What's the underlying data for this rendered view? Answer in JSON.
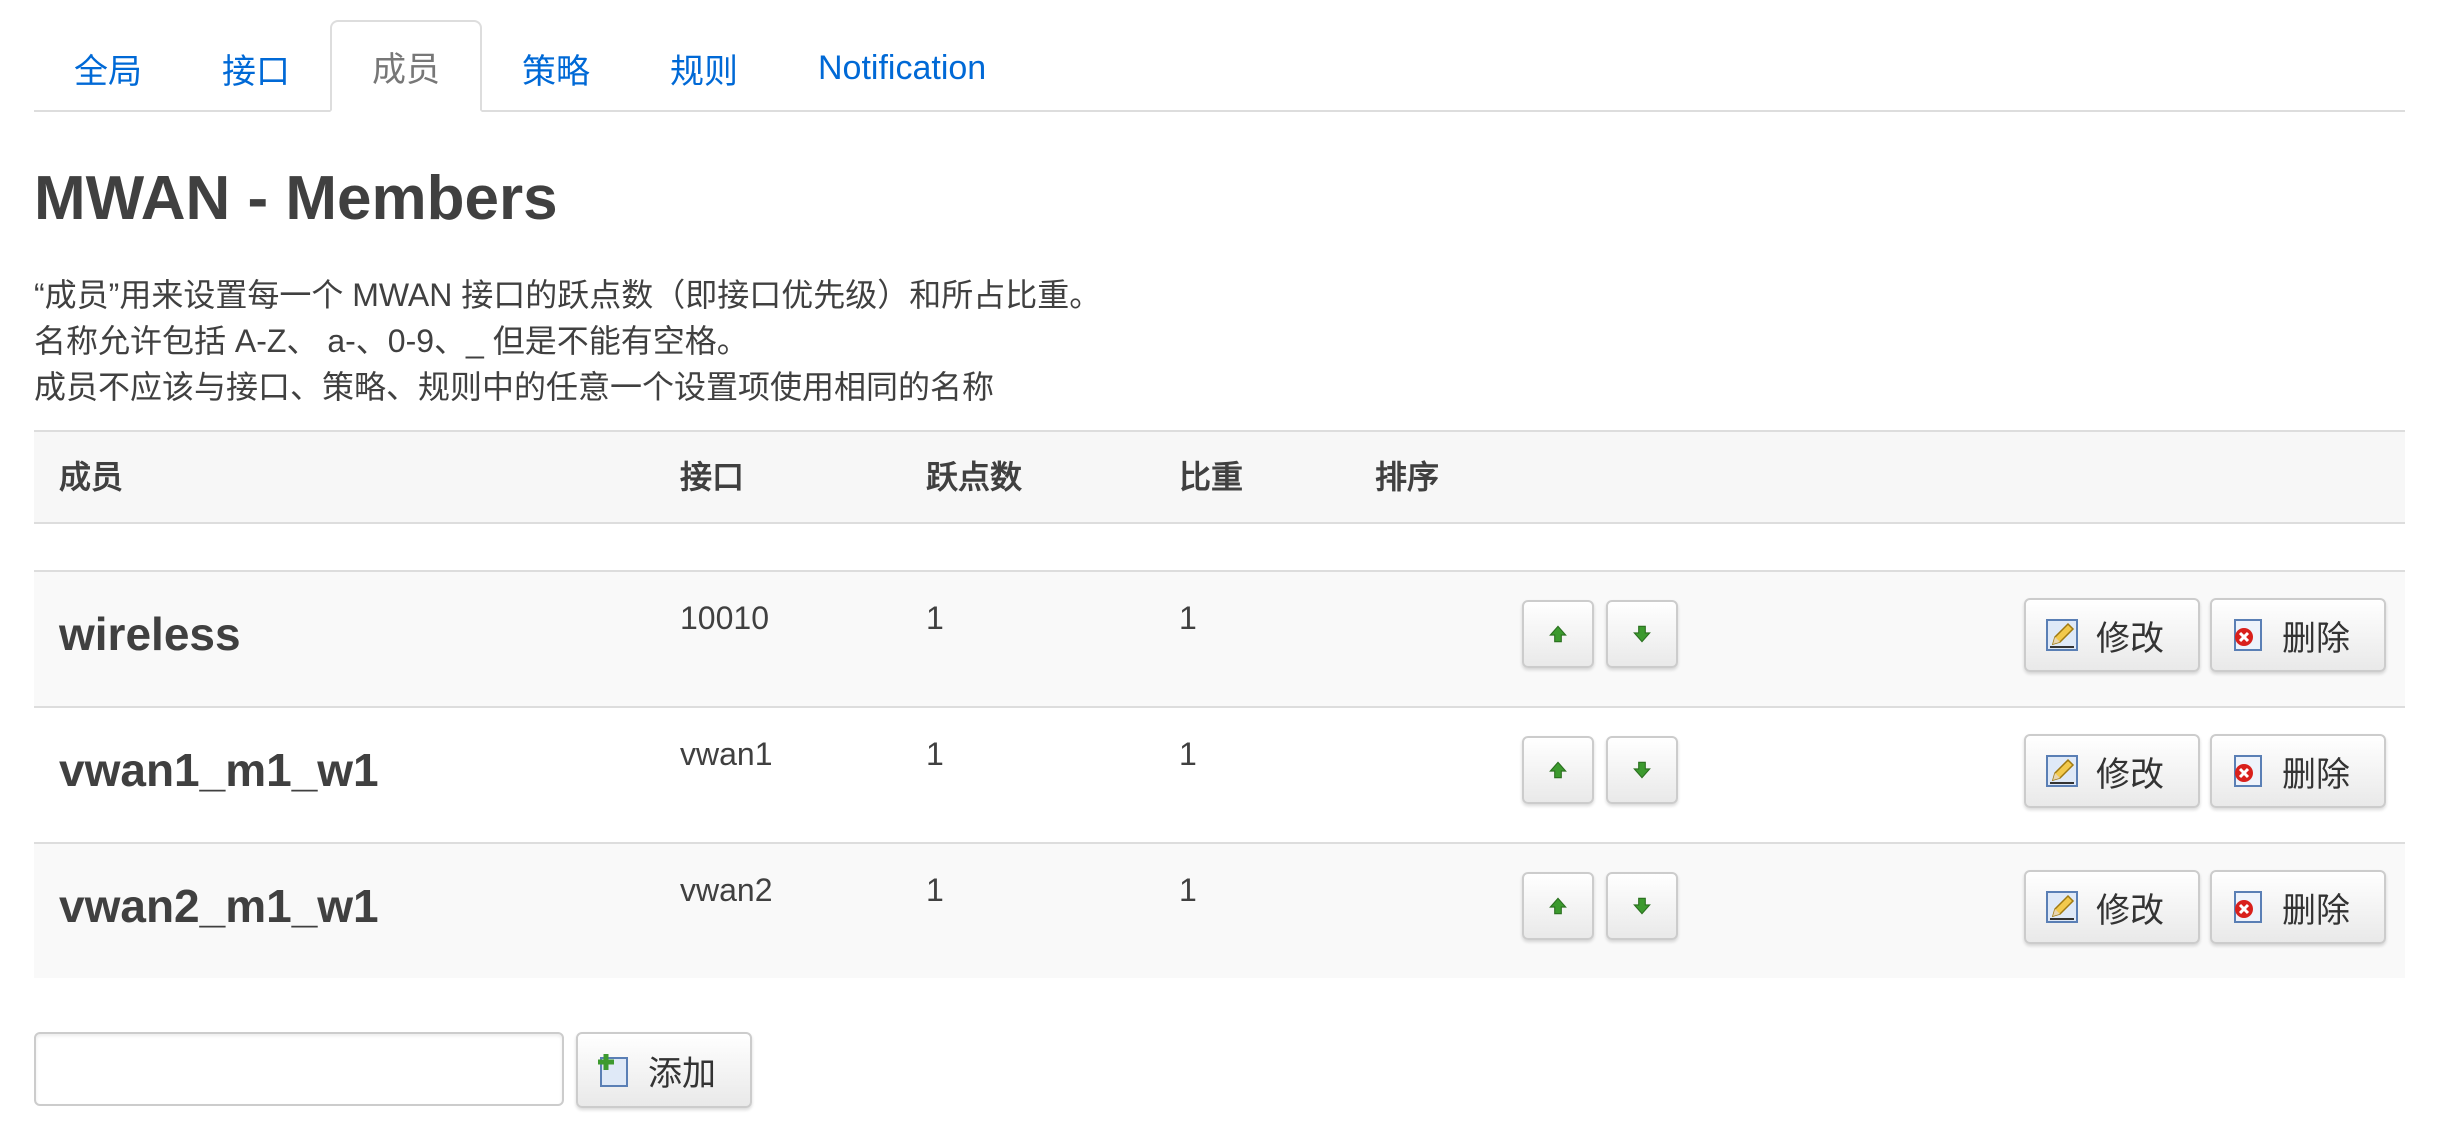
{
  "tabs": [
    {
      "label": "全局",
      "active": false
    },
    {
      "label": "接口",
      "active": false
    },
    {
      "label": "成员",
      "active": true
    },
    {
      "label": "策略",
      "active": false
    },
    {
      "label": "规则",
      "active": false
    },
    {
      "label": "Notification",
      "active": false
    }
  ],
  "page": {
    "title": "MWAN - Members",
    "description": [
      "“成员”用来设置每一个 MWAN 接口的跃点数（即接口优先级）和所占比重。",
      "名称允许包括 A-Z、 a-、0-9、_ 但是不能有空格。",
      "成员不应该与接口、策略、规则中的任意一个设置项使用相同的名称"
    ]
  },
  "table": {
    "headers": {
      "member": "成员",
      "interface": "接口",
      "metric": "跃点数",
      "weight": "比重",
      "sort": "排序"
    },
    "rows": [
      {
        "name": "wireless",
        "interface": "10010",
        "metric": "1",
        "weight": "1"
      },
      {
        "name": "vwan1_m1_w1",
        "interface": "vwan1",
        "metric": "1",
        "weight": "1"
      },
      {
        "name": "vwan2_m1_w1",
        "interface": "vwan2",
        "metric": "1",
        "weight": "1"
      }
    ],
    "edit_label": "修改",
    "delete_label": "删除"
  },
  "add": {
    "input_value": "",
    "button_label": "添加"
  },
  "colors": {
    "link": "#0069d6",
    "arrow_green": "#3c9a2e",
    "delete_red": "#d9201c",
    "border": "#dddddd"
  },
  "icons": {
    "sort_up": "arrow-up-icon",
    "sort_down": "arrow-down-icon",
    "edit": "edit-pencil-icon",
    "delete": "delete-x-icon",
    "add": "add-plus-icon"
  }
}
